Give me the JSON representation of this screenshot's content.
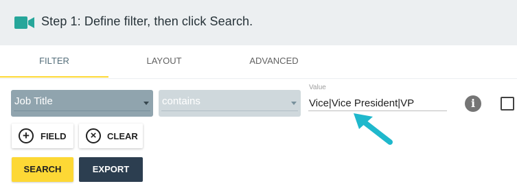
{
  "step": {
    "title": "Step 1: Define filter, then click Search.",
    "icon": "video-camera-icon",
    "icon_color": "#26a69a"
  },
  "tabs": [
    {
      "label": "FILTER",
      "active": true
    },
    {
      "label": "LAYOUT",
      "active": false
    },
    {
      "label": "ADVANCED",
      "active": false
    }
  ],
  "filter": {
    "field_select": "Job Title",
    "operator_select": "contains",
    "value_label": "Value",
    "value": "Vice|Vice President|VP",
    "info_icon": "info-icon",
    "checkbox_checked": false
  },
  "buttons": {
    "field": "FIELD",
    "clear": "CLEAR",
    "search": "SEARCH",
    "export": "EXPORT"
  },
  "colors": {
    "accent_yellow": "#fdd835",
    "export_dark": "#2c3e50",
    "arrow_cyan": "#1fb8cc"
  }
}
